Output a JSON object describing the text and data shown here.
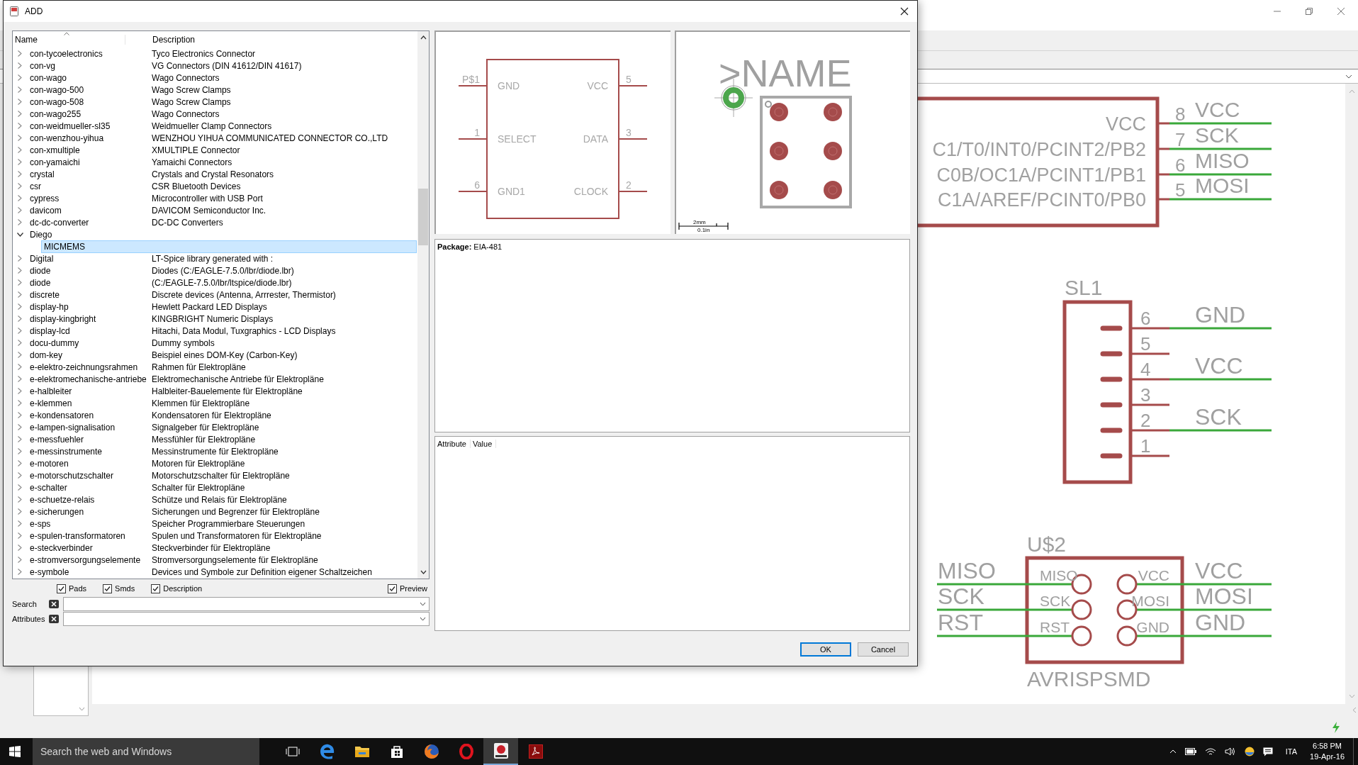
{
  "schematic": {
    "chip": {
      "pins": [
        {
          "label": "VCC",
          "number": "8",
          "net": "VCC"
        },
        {
          "label": "C1/T0/INT0/PCINT2/PB2",
          "number": "7",
          "net": "SCK"
        },
        {
          "label": "C0B/OC1A/PCINT1/PB1",
          "number": "6",
          "net": "MISO"
        },
        {
          "label": "C1A/AREF/PCINT0/PB0",
          "number": "5",
          "net": "MOSI"
        }
      ]
    },
    "connector": {
      "name": "SL1",
      "pins": [
        {
          "number": "6",
          "net": "GND"
        },
        {
          "number": "5"
        },
        {
          "number": "4",
          "net": "VCC"
        },
        {
          "number": "3"
        },
        {
          "number": "2",
          "net": "SCK"
        },
        {
          "number": "1"
        }
      ]
    },
    "header": {
      "name": "U$2",
      "value": "AVRISPSMD",
      "rows": [
        {
          "net_left": "MISO",
          "pin_left": "MISO",
          "pin_right": "VCC",
          "net_right": "VCC"
        },
        {
          "net_left": "SCK",
          "pin_left": "SCK",
          "pin_right": "MOSI",
          "net_right": "MOSI"
        },
        {
          "net_left": "RST",
          "pin_left": "RST",
          "pin_right": "GND",
          "net_right": "GND"
        }
      ]
    }
  },
  "dialog": {
    "title": "ADD",
    "library": {
      "columns": [
        "Name",
        "Description"
      ],
      "rows": [
        {
          "name": "con-tycoelectronics",
          "description": "Tyco Electronics Connector",
          "expanded": false,
          "selected": false
        },
        {
          "name": "con-vg",
          "description": "VG Connectors (DIN 41612/DIN 41617)",
          "expanded": false,
          "selected": false
        },
        {
          "name": "con-wago",
          "description": "Wago Connectors",
          "expanded": false,
          "selected": false
        },
        {
          "name": "con-wago-500",
          "description": "Wago Screw Clamps",
          "expanded": false,
          "selected": false
        },
        {
          "name": "con-wago-508",
          "description": "Wago Screw Clamps",
          "expanded": false,
          "selected": false
        },
        {
          "name": "con-wago255",
          "description": "Wago Connectors",
          "expanded": false,
          "selected": false
        },
        {
          "name": "con-weidmueller-sl35",
          "description": "Weidmueller Clamp Connectors",
          "expanded": false,
          "selected": false
        },
        {
          "name": "con-wenzhou-yihua",
          "description": "WENZHOU YIHUA COMMUNICATED CONNECTOR CO.,LTD",
          "expanded": false,
          "selected": false
        },
        {
          "name": "con-xmultiple",
          "description": "XMULTIPLE Connector",
          "expanded": false,
          "selected": false
        },
        {
          "name": "con-yamaichi",
          "description": "Yamaichi Connectors",
          "expanded": false,
          "selected": false
        },
        {
          "name": "crystal",
          "description": "Crystals and Crystal Resonators",
          "expanded": false,
          "selected": false
        },
        {
          "name": "csr",
          "description": "CSR Bluetooth Devices",
          "expanded": false,
          "selected": false
        },
        {
          "name": "cypress",
          "description": "Microcontroller with USB Port",
          "expanded": false,
          "selected": false
        },
        {
          "name": "davicom",
          "description": "DAVICOM Semiconductor Inc.",
          "expanded": false,
          "selected": false
        },
        {
          "name": "dc-dc-converter",
          "description": "DC-DC Converters",
          "expanded": false,
          "selected": false
        },
        {
          "name": "Diego",
          "expanded": true,
          "selected": false,
          "children": [
            {
              "name": "MICMEMS",
              "selected": true
            }
          ]
        },
        {
          "name": "Digital",
          "description": "LT-Spice library generated with :",
          "expanded": false,
          "selected": false
        },
        {
          "name": "diode",
          "description": "Diodes (C:/EAGLE-7.5.0/lbr/diode.lbr)",
          "expanded": false,
          "selected": false
        },
        {
          "name": "diode",
          "description": "(C:/EAGLE-7.5.0/lbr/ltspice/diode.lbr)",
          "expanded": false,
          "selected": false
        },
        {
          "name": "discrete",
          "description": "Discrete devices (Antenna, Arrrester, Thermistor)",
          "expanded": false,
          "selected": false
        },
        {
          "name": "display-hp",
          "description": "Hewlett Packard LED Displays",
          "expanded": false,
          "selected": false
        },
        {
          "name": "display-kingbright",
          "description": "KINGBRIGHT Numeric Displays",
          "expanded": false,
          "selected": false
        },
        {
          "name": "display-lcd",
          "description": "Hitachi, Data Modul, Tuxgraphics - LCD Displays",
          "expanded": false,
          "selected": false
        },
        {
          "name": "docu-dummy",
          "description": "Dummy symbols",
          "expanded": false,
          "selected": false
        },
        {
          "name": "dom-key",
          "description": "Beispiel eines DOM-Key (Carbon-Key)",
          "expanded": false,
          "selected": false
        },
        {
          "name": "e-elektro-zeichnungsrahmen",
          "description": "Rahmen für Elektropläne",
          "expanded": false,
          "selected": false
        },
        {
          "name": "e-elektromechanische-antriebe",
          "description": "Elektromechanische Antriebe  für Elektropläne",
          "expanded": false,
          "selected": false
        },
        {
          "name": "e-halbleiter",
          "description": "Halbleiter-Bauelemente für Elektropläne",
          "expanded": false,
          "selected": false
        },
        {
          "name": "e-klemmen",
          "description": "Klemmen für Elektropläne",
          "expanded": false,
          "selected": false
        },
        {
          "name": "e-kondensatoren",
          "description": "Kondensatoren für Elektropläne",
          "expanded": false,
          "selected": false
        },
        {
          "name": "e-lampen-signalisation",
          "description": "Signalgeber für Elektropläne",
          "expanded": false,
          "selected": false
        },
        {
          "name": "e-messfuehler",
          "description": "Messfühler für Elektropläne",
          "expanded": false,
          "selected": false
        },
        {
          "name": "e-messinstrumente",
          "description": "Messinstrumente für Elektropläne",
          "expanded": false,
          "selected": false
        },
        {
          "name": "e-motoren",
          "description": "Motoren für Elektropläne",
          "expanded": false,
          "selected": false
        },
        {
          "name": "e-motorschutzschalter",
          "description": "Motorschutzschalter für Elektropläne",
          "expanded": false,
          "selected": false
        },
        {
          "name": "e-schalter",
          "description": "Schalter für Elektropläne",
          "expanded": false,
          "selected": false
        },
        {
          "name": "e-schuetze-relais",
          "description": "Schütze und Relais für Elektropläne",
          "expanded": false,
          "selected": false
        },
        {
          "name": "e-sicherungen",
          "description": "Sicherungen und Begrenzer für Elektropläne",
          "expanded": false,
          "selected": false
        },
        {
          "name": "e-sps",
          "description": "Speicher Programmierbare Steuerungen",
          "expanded": false,
          "selected": false
        },
        {
          "name": "e-spulen-transformatoren",
          "description": "Spulen und Transformatoren für Elektropläne",
          "expanded": false,
          "selected": false
        },
        {
          "name": "e-steckverbinder",
          "description": "Steckverbinder für Elektropläne",
          "expanded": false,
          "selected": false
        },
        {
          "name": "e-stromversorgungselemente",
          "description": "Stromversorgungselemente für Elektropläne",
          "expanded": false,
          "selected": false
        },
        {
          "name": "e-symbole",
          "description": "Devices und Symbole zur Definition eigener Schaltzeichen",
          "expanded": false,
          "selected": false
        }
      ]
    },
    "options": [
      {
        "label": "Pads",
        "checked": true
      },
      {
        "label": "Smds",
        "checked": true
      },
      {
        "label": "Description",
        "checked": true
      },
      {
        "label": "Preview",
        "checked": true
      }
    ],
    "filters": [
      {
        "label": "Search"
      },
      {
        "label": "Attributes"
      }
    ],
    "symbol": {
      "left_pins": [
        {
          "number": "P$1",
          "name": "GND"
        },
        {
          "number": "1",
          "name": "SELECT"
        },
        {
          "number": "6",
          "name": "GND1"
        }
      ],
      "right_pins": [
        {
          "number": "5",
          "name": "VCC"
        },
        {
          "number": "3",
          "name": "DATA"
        },
        {
          "number": "2",
          "name": "CLOCK"
        }
      ]
    },
    "package": {
      "name_label": ">NAME",
      "scale_metric": "2mm",
      "scale_imperial": "0.1in"
    },
    "description": "**Package:** EIA-481",
    "attributes": {
      "columns": [
        "Attribute",
        "Value"
      ]
    },
    "buttons": [
      {
        "label": "OK",
        "default": true
      },
      {
        "label": "Cancel",
        "default": false
      }
    ]
  },
  "taskbar": {
    "search_placeholder": "Search the web and Windows",
    "apps": [
      {
        "kind": "task-view",
        "selected": false
      },
      {
        "kind": "edge",
        "selected": false
      },
      {
        "kind": "folder",
        "selected": false
      },
      {
        "kind": "store",
        "selected": false
      },
      {
        "kind": "firefox",
        "selected": false
      },
      {
        "kind": "opera",
        "selected": false
      },
      {
        "kind": "eagle",
        "selected": true
      },
      {
        "kind": "pdf",
        "selected": false
      }
    ],
    "language": "ITA",
    "time": "6:58 PM",
    "date": "19-Apr-16"
  }
}
